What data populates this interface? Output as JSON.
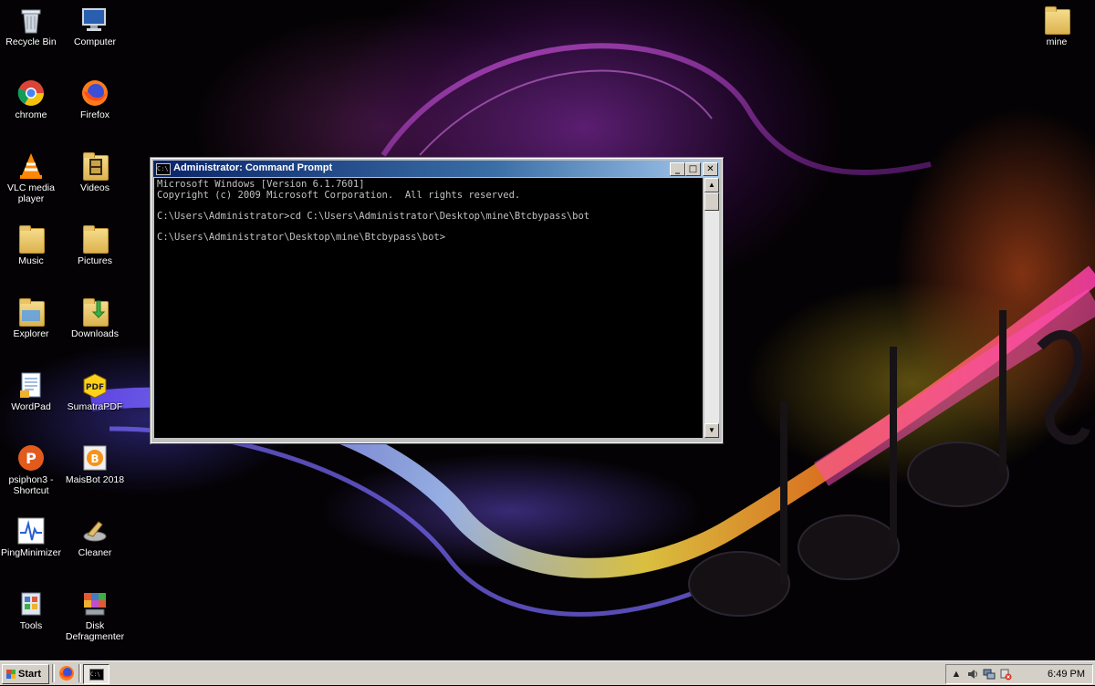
{
  "desktop_icons": [
    {
      "id": "recycle-bin",
      "label": "Recycle Bin",
      "icon": "recycle-bin-icon"
    },
    {
      "id": "computer",
      "label": "Computer",
      "icon": "computer-icon"
    },
    {
      "id": "chrome",
      "label": "chrome",
      "icon": "chrome-icon"
    },
    {
      "id": "firefox",
      "label": "Firefox",
      "icon": "firefox-icon"
    },
    {
      "id": "vlc",
      "label": "VLC media player",
      "icon": "vlc-icon"
    },
    {
      "id": "videos",
      "label": "Videos",
      "icon": "videos-folder-icon"
    },
    {
      "id": "music",
      "label": "Music",
      "icon": "folder-icon"
    },
    {
      "id": "pictures",
      "label": "Pictures",
      "icon": "folder-icon"
    },
    {
      "id": "explorer",
      "label": "Explorer",
      "icon": "explorer-icon"
    },
    {
      "id": "downloads",
      "label": "Downloads",
      "icon": "downloads-folder-icon"
    },
    {
      "id": "wordpad",
      "label": "WordPad",
      "icon": "wordpad-icon"
    },
    {
      "id": "sumatra",
      "label": "SumatraPDF",
      "icon": "sumatrapdf-icon"
    },
    {
      "id": "psiphon",
      "label": "psiphon3 - Shortcut",
      "icon": "psiphon-icon"
    },
    {
      "id": "maisbot",
      "label": "MaisBot 2018",
      "icon": "maisbot-icon"
    },
    {
      "id": "pingminimizer",
      "label": "PingMinimizer",
      "icon": "pingminimizer-icon"
    },
    {
      "id": "cleaner",
      "label": "Cleaner",
      "icon": "cleaner-icon"
    },
    {
      "id": "tools",
      "label": "Tools",
      "icon": "tools-icon"
    },
    {
      "id": "defrag",
      "label": "Disk Defragmenter",
      "icon": "disk-defragmenter-icon"
    },
    {
      "id": "mine",
      "label": "mine",
      "icon": "folder-icon"
    }
  ],
  "cmd_window": {
    "title": "Administrator: Command Prompt",
    "icon_text": "C:\\",
    "minimize": "_",
    "maximize": "□",
    "close": "✕",
    "console_text": "Microsoft Windows [Version 6.1.7601]\nCopyright (c) 2009 Microsoft Corporation.  All rights reserved.\n\nC:\\Users\\Administrator>cd C:\\Users\\Administrator\\Desktop\\mine\\Btcbypass\\bot\n\nC:\\Users\\Administrator\\Desktop\\mine\\Btcbypass\\bot>",
    "scroll_up": "▲",
    "scroll_down": "▼"
  },
  "taskbar": {
    "start_label": "Start",
    "task_cmd_icon_text": "C:\\",
    "clock": "6:49 PM",
    "tray_icons": [
      "chevron-up-icon",
      "volume-icon",
      "network-icon",
      "action-center-icon"
    ]
  }
}
